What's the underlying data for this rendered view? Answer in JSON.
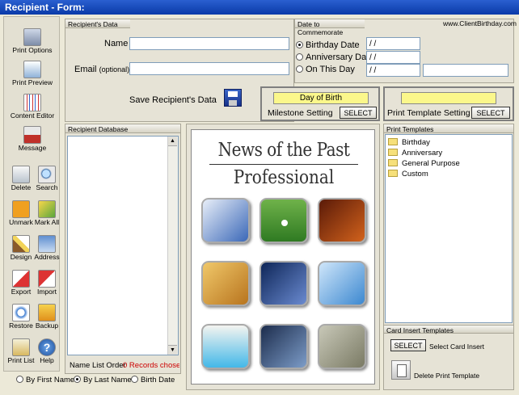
{
  "window": {
    "title": "Recipient  -  Form:"
  },
  "toolbar": [
    {
      "label": "Print Options",
      "icon": "print-options-icon"
    },
    {
      "label": "Print Preview",
      "icon": "print-preview-icon"
    },
    {
      "label": "Content Editor",
      "icon": "content-editor-icon"
    },
    {
      "label": "Message",
      "icon": "message-icon"
    },
    {
      "label": "Delete",
      "icon": "trash-icon"
    },
    {
      "label": "Search",
      "icon": "magnifier-icon"
    },
    {
      "label": "Unmark",
      "icon": "unmark-icon"
    },
    {
      "label": "Mark All",
      "icon": "checkmark-icon"
    },
    {
      "label": "Design",
      "icon": "paintbrush-icon"
    },
    {
      "label": "Address",
      "icon": "address-card-icon"
    },
    {
      "label": "Export",
      "icon": "export-icon"
    },
    {
      "label": "Import",
      "icon": "import-icon"
    },
    {
      "label": "Restore",
      "icon": "restore-icon"
    },
    {
      "label": "Backup",
      "icon": "backup-icon"
    },
    {
      "label": "Print List",
      "icon": "print-list-icon"
    },
    {
      "label": "Help",
      "icon": "help-icon"
    }
  ],
  "recipient": {
    "header": "Recipient's Data",
    "name_label": "Name",
    "email_label": "Email",
    "email_optional": "(optional)",
    "name_value": "",
    "email_value": "",
    "save_label": "Save Recipient's Data"
  },
  "commemorate": {
    "header": "Date to Commemorate",
    "website": "www.ClientBirthday.com",
    "options": [
      "Birthday Date",
      "Anniversary Date",
      "On This Day"
    ],
    "selected": 0,
    "dates": [
      "/ /",
      "/ /",
      "/ /"
    ]
  },
  "milestone": {
    "value": "Day of Birth",
    "label": "Milestone Setting",
    "button": "SELECT"
  },
  "print_template_setting": {
    "value": "",
    "label": "Print Template Setting",
    "button": "SELECT"
  },
  "database": {
    "header": "Recipient Database",
    "order_label": "Name List Order",
    "records": "0 Records chose",
    "sort_options": [
      "By First Name",
      "By Last Name",
      "Birth Date"
    ],
    "sort_selected": 1
  },
  "preview": {
    "title_line1": "News of the Past",
    "title_line2": "Professional"
  },
  "templates": {
    "header": "Print Templates",
    "items": [
      "Birthday",
      "Anniversary",
      "General Purpose",
      "Custom"
    ]
  },
  "card_insert": {
    "header": "Card Insert Templates",
    "button": "SELECT",
    "label": "Select Card Insert",
    "delete_label": "Delete Print Template"
  },
  "colors": {
    "accent": "#0a3aa8",
    "records": "#cc0000",
    "highlight": "#fbf78b"
  }
}
